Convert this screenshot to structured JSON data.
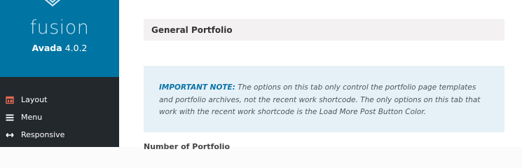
{
  "brand": {
    "logo_text": "fusion",
    "product": "Avada",
    "version": "4.0.2"
  },
  "nav": {
    "items": [
      {
        "label": "Layout",
        "icon": "layout-icon"
      },
      {
        "label": "Menu",
        "icon": "menu-icon"
      },
      {
        "label": "Responsive",
        "icon": "responsive-arrow-icon"
      }
    ]
  },
  "main": {
    "section_title": "General Portfolio",
    "note_label": "IMPORTANT NOTE:",
    "note_text": " The options on this tab only control the portfolio page templates and portfolio archives, not the recent work shortcode. The only options on this tab that work with the recent work shortcode is the Load More Post Button Color.",
    "next_heading": "Number of Portfolio Items Per Page"
  },
  "colors": {
    "brand_blue": "#0074a2",
    "sidebar_dark": "#23282d",
    "note_bg": "#e6f1f7",
    "note_label": "#0c72a8"
  }
}
